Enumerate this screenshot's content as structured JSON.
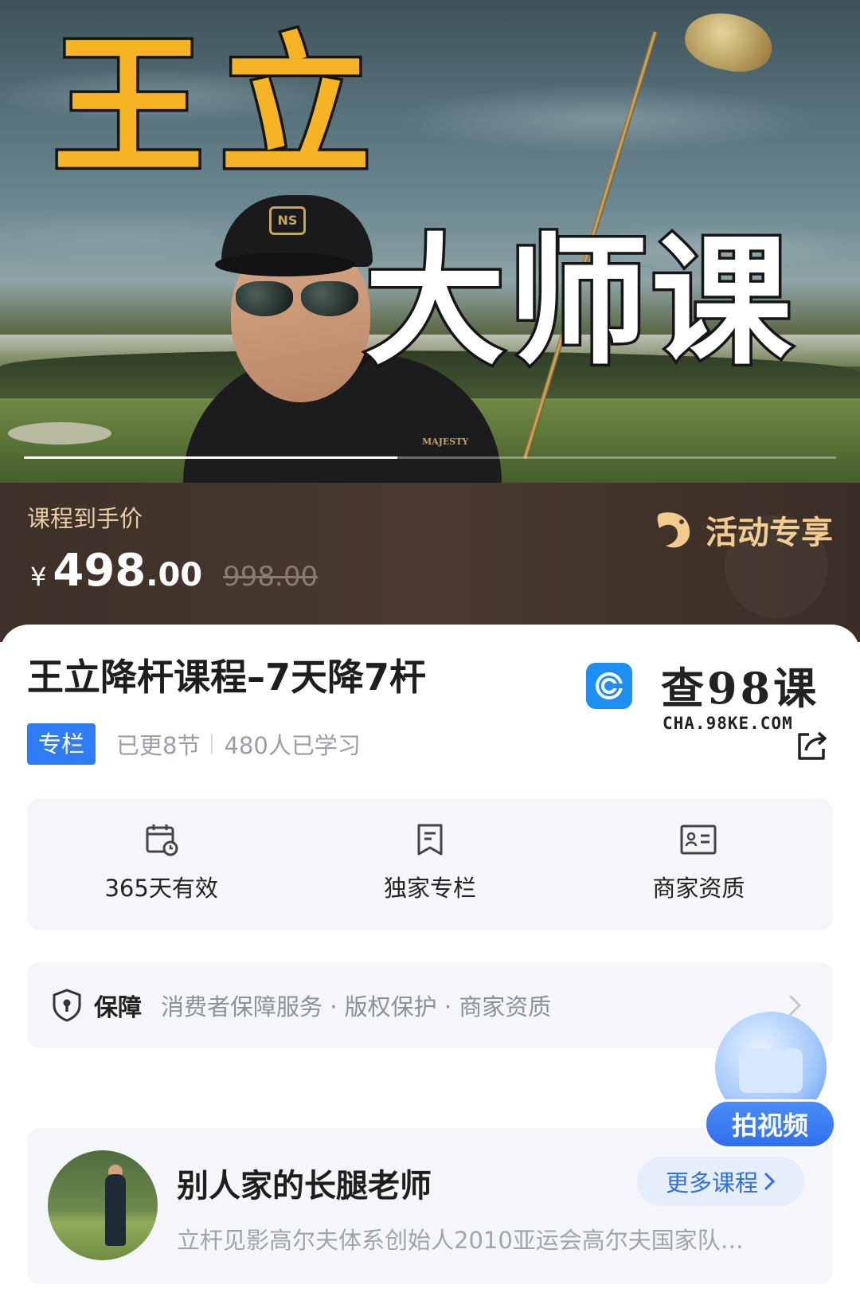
{
  "hero": {
    "title_line1": "王立",
    "title_line2": "大师课",
    "cap_logo": "NS",
    "shirt_brand": "MAJESTY",
    "carousel_progress": 0.46
  },
  "price": {
    "label": "课程到手价",
    "symbol": "¥",
    "integer": "498",
    "decimal": ".00",
    "original": "998.00",
    "promo_label": "活动专享"
  },
  "course": {
    "title": "王立降杆课程–7天降7杆",
    "tag": "专栏",
    "updated": "已更8节",
    "learners": "480人已学习"
  },
  "watermark": {
    "text": "查98课",
    "url": "CHA.98KE.COM"
  },
  "features": [
    {
      "label": "365天有效",
      "icon": "calendar-clock-icon"
    },
    {
      "label": "独家专栏",
      "icon": "bookmark-doc-icon"
    },
    {
      "label": "商家资质",
      "icon": "id-card-icon"
    }
  ],
  "guarantee": {
    "title": "保障",
    "items": "消费者保障服务 · 版权保护 · 商家资质"
  },
  "teacher": {
    "name": "别人家的长腿老师",
    "description": "立杆见影高尔夫体系创始人2010亚运会高尔夫国家队…",
    "more_label": "更多课程"
  },
  "fab": {
    "label": "拍视频"
  },
  "colors": {
    "accent_blue": "#2f7cf6",
    "price_bg": "#3d3028",
    "hero_title_gold": "#f6b324"
  }
}
